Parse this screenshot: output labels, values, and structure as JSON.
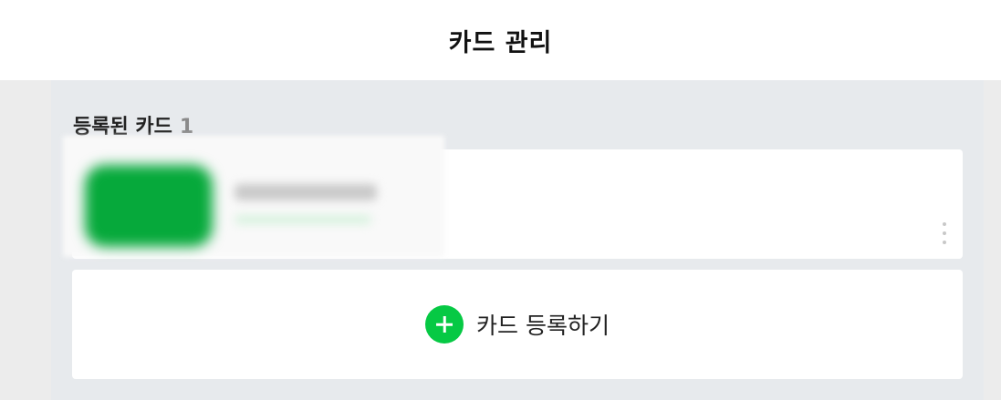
{
  "header": {
    "title": "카드 관리"
  },
  "registered": {
    "label": "등록된 카드",
    "count": "1"
  },
  "card_item": {
    "thumbnail_icon": "card-thumbnail",
    "more_icon": "more-vertical-icon",
    "accent_color": "#06a93b"
  },
  "add_card": {
    "label": "카드 등록하기",
    "icon": "plus-circle-icon",
    "icon_color": "#06c944"
  }
}
